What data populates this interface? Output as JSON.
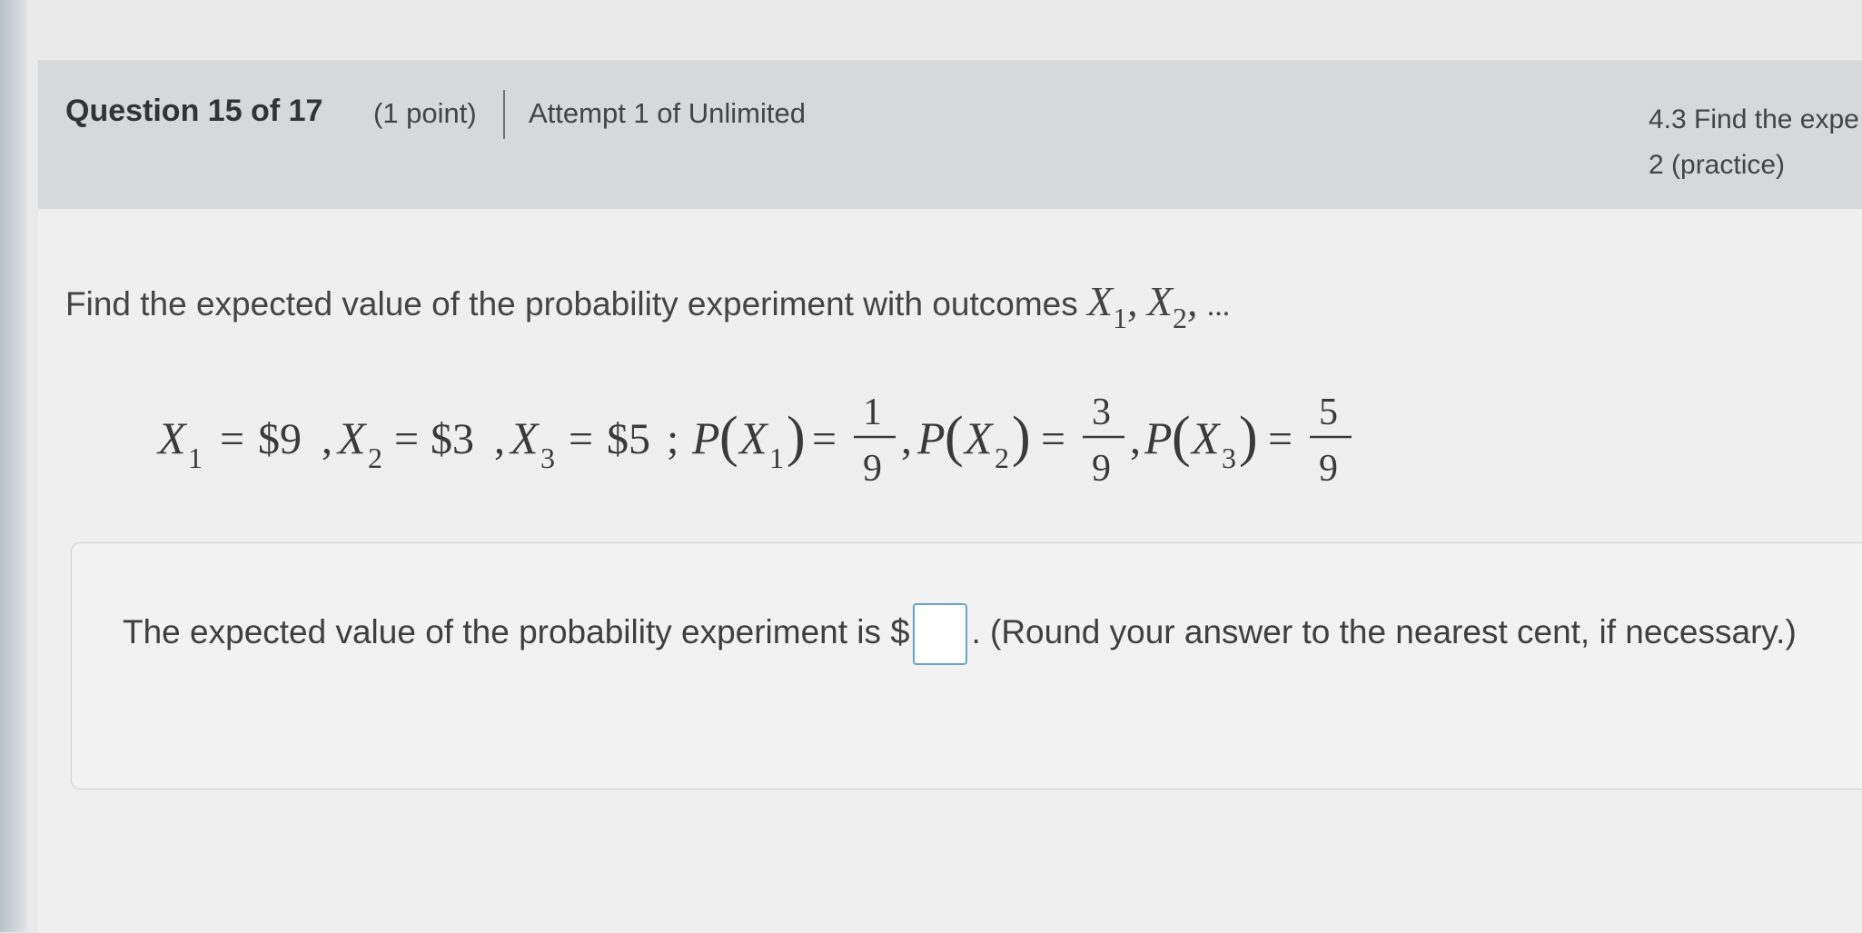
{
  "header": {
    "question_label": "Question 15 of 17",
    "points": "(1 point)",
    "attempt": "Attempt 1 of Unlimited",
    "section_line1": "4.3 Find the expe",
    "section_line2": "2 (practice)"
  },
  "problem": {
    "prompt": "Find the expected value of the probability experiment with outcomes",
    "outcome_var": "X",
    "sub1": "1",
    "sub2": "2",
    "sep": ",",
    "ellipsis": "...",
    "equation": {
      "x1": {
        "name": "X",
        "sub": "1",
        "value": "$9"
      },
      "x2": {
        "name": "X",
        "sub": "2",
        "value": "$3"
      },
      "x3": {
        "name": "X",
        "sub": "3",
        "value": "$5"
      },
      "p1": {
        "num": "1",
        "den": "9"
      },
      "p2": {
        "num": "3",
        "den": "9"
      },
      "p3": {
        "num": "5",
        "den": "9"
      }
    }
  },
  "answer": {
    "text_before": "The expected value of the probability experiment is",
    "currency": "$",
    "input_value": "",
    "text_after": ". (Round your answer to the nearest cent, if necessary.)"
  }
}
